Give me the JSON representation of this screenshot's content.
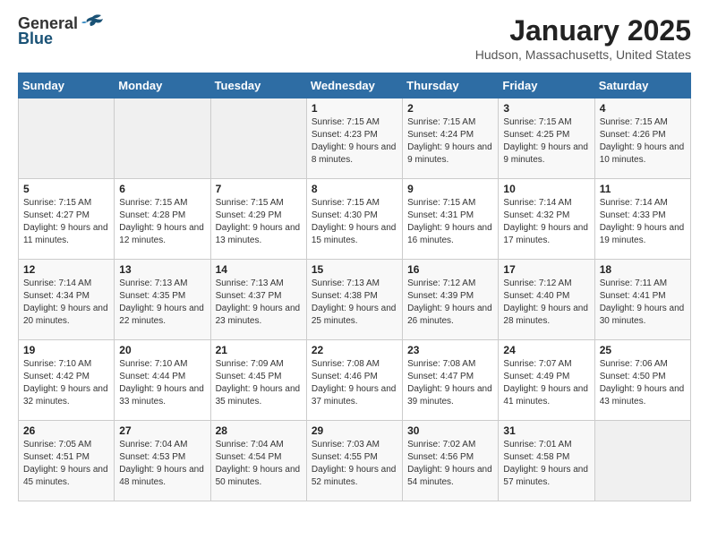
{
  "header": {
    "logo_general": "General",
    "logo_blue": "Blue",
    "title": "January 2025",
    "subtitle": "Hudson, Massachusetts, United States"
  },
  "days_of_week": [
    "Sunday",
    "Monday",
    "Tuesday",
    "Wednesday",
    "Thursday",
    "Friday",
    "Saturday"
  ],
  "weeks": [
    [
      {
        "day": "",
        "info": ""
      },
      {
        "day": "",
        "info": ""
      },
      {
        "day": "",
        "info": ""
      },
      {
        "day": "1",
        "info": "Sunrise: 7:15 AM\nSunset: 4:23 PM\nDaylight: 9 hours and 8 minutes."
      },
      {
        "day": "2",
        "info": "Sunrise: 7:15 AM\nSunset: 4:24 PM\nDaylight: 9 hours and 9 minutes."
      },
      {
        "day": "3",
        "info": "Sunrise: 7:15 AM\nSunset: 4:25 PM\nDaylight: 9 hours and 9 minutes."
      },
      {
        "day": "4",
        "info": "Sunrise: 7:15 AM\nSunset: 4:26 PM\nDaylight: 9 hours and 10 minutes."
      }
    ],
    [
      {
        "day": "5",
        "info": "Sunrise: 7:15 AM\nSunset: 4:27 PM\nDaylight: 9 hours and 11 minutes."
      },
      {
        "day": "6",
        "info": "Sunrise: 7:15 AM\nSunset: 4:28 PM\nDaylight: 9 hours and 12 minutes."
      },
      {
        "day": "7",
        "info": "Sunrise: 7:15 AM\nSunset: 4:29 PM\nDaylight: 9 hours and 13 minutes."
      },
      {
        "day": "8",
        "info": "Sunrise: 7:15 AM\nSunset: 4:30 PM\nDaylight: 9 hours and 15 minutes."
      },
      {
        "day": "9",
        "info": "Sunrise: 7:15 AM\nSunset: 4:31 PM\nDaylight: 9 hours and 16 minutes."
      },
      {
        "day": "10",
        "info": "Sunrise: 7:14 AM\nSunset: 4:32 PM\nDaylight: 9 hours and 17 minutes."
      },
      {
        "day": "11",
        "info": "Sunrise: 7:14 AM\nSunset: 4:33 PM\nDaylight: 9 hours and 19 minutes."
      }
    ],
    [
      {
        "day": "12",
        "info": "Sunrise: 7:14 AM\nSunset: 4:34 PM\nDaylight: 9 hours and 20 minutes."
      },
      {
        "day": "13",
        "info": "Sunrise: 7:13 AM\nSunset: 4:35 PM\nDaylight: 9 hours and 22 minutes."
      },
      {
        "day": "14",
        "info": "Sunrise: 7:13 AM\nSunset: 4:37 PM\nDaylight: 9 hours and 23 minutes."
      },
      {
        "day": "15",
        "info": "Sunrise: 7:13 AM\nSunset: 4:38 PM\nDaylight: 9 hours and 25 minutes."
      },
      {
        "day": "16",
        "info": "Sunrise: 7:12 AM\nSunset: 4:39 PM\nDaylight: 9 hours and 26 minutes."
      },
      {
        "day": "17",
        "info": "Sunrise: 7:12 AM\nSunset: 4:40 PM\nDaylight: 9 hours and 28 minutes."
      },
      {
        "day": "18",
        "info": "Sunrise: 7:11 AM\nSunset: 4:41 PM\nDaylight: 9 hours and 30 minutes."
      }
    ],
    [
      {
        "day": "19",
        "info": "Sunrise: 7:10 AM\nSunset: 4:42 PM\nDaylight: 9 hours and 32 minutes."
      },
      {
        "day": "20",
        "info": "Sunrise: 7:10 AM\nSunset: 4:44 PM\nDaylight: 9 hours and 33 minutes."
      },
      {
        "day": "21",
        "info": "Sunrise: 7:09 AM\nSunset: 4:45 PM\nDaylight: 9 hours and 35 minutes."
      },
      {
        "day": "22",
        "info": "Sunrise: 7:08 AM\nSunset: 4:46 PM\nDaylight: 9 hours and 37 minutes."
      },
      {
        "day": "23",
        "info": "Sunrise: 7:08 AM\nSunset: 4:47 PM\nDaylight: 9 hours and 39 minutes."
      },
      {
        "day": "24",
        "info": "Sunrise: 7:07 AM\nSunset: 4:49 PM\nDaylight: 9 hours and 41 minutes."
      },
      {
        "day": "25",
        "info": "Sunrise: 7:06 AM\nSunset: 4:50 PM\nDaylight: 9 hours and 43 minutes."
      }
    ],
    [
      {
        "day": "26",
        "info": "Sunrise: 7:05 AM\nSunset: 4:51 PM\nDaylight: 9 hours and 45 minutes."
      },
      {
        "day": "27",
        "info": "Sunrise: 7:04 AM\nSunset: 4:53 PM\nDaylight: 9 hours and 48 minutes."
      },
      {
        "day": "28",
        "info": "Sunrise: 7:04 AM\nSunset: 4:54 PM\nDaylight: 9 hours and 50 minutes."
      },
      {
        "day": "29",
        "info": "Sunrise: 7:03 AM\nSunset: 4:55 PM\nDaylight: 9 hours and 52 minutes."
      },
      {
        "day": "30",
        "info": "Sunrise: 7:02 AM\nSunset: 4:56 PM\nDaylight: 9 hours and 54 minutes."
      },
      {
        "day": "31",
        "info": "Sunrise: 7:01 AM\nSunset: 4:58 PM\nDaylight: 9 hours and 57 minutes."
      },
      {
        "day": "",
        "info": ""
      }
    ]
  ]
}
